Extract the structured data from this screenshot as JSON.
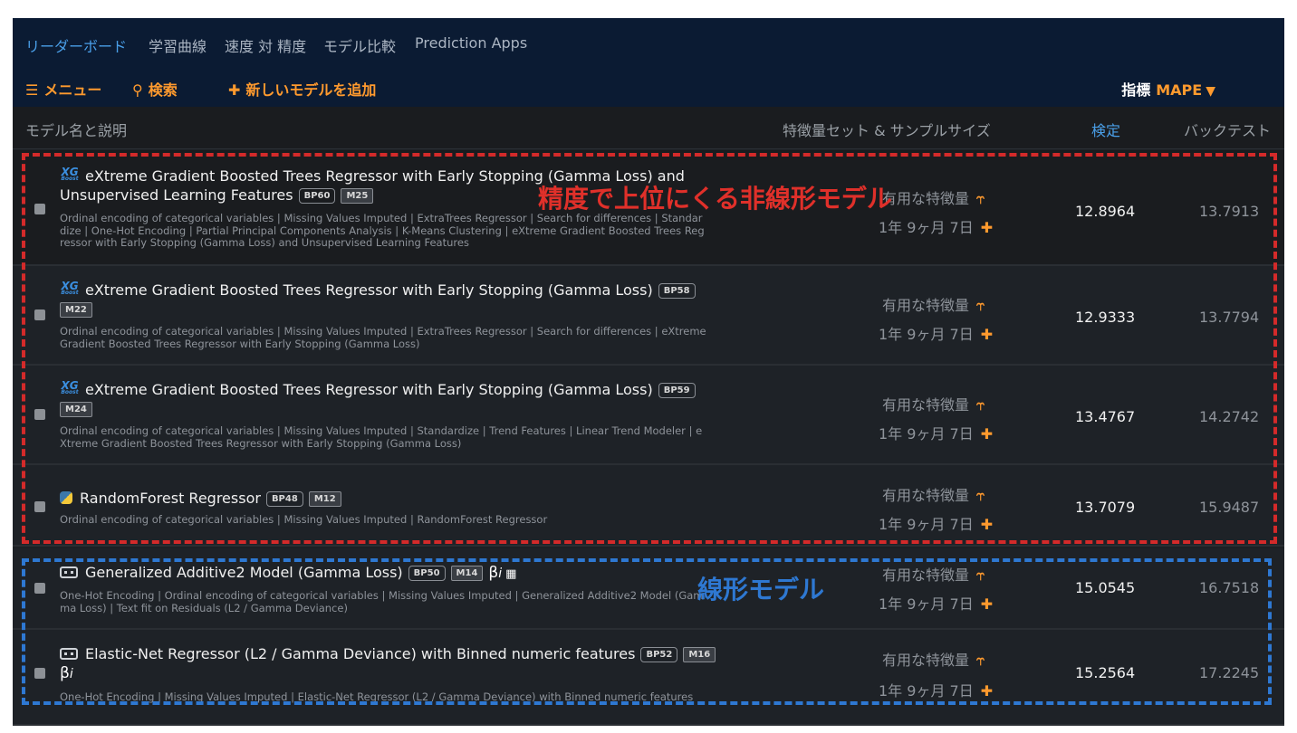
{
  "nav": {
    "tabs": [
      "リーダーボード",
      "学習曲線",
      "速度 対 精度",
      "モデル比較",
      "Prediction Apps"
    ]
  },
  "toolbar": {
    "menu": "メニュー",
    "search": "検索",
    "add_model": "新しいモデルを追加",
    "metric_label": "指標",
    "metric_value": "MAPE"
  },
  "columns": {
    "name": "モデル名と説明",
    "features": "特徴量セット & サンプルサイズ",
    "validation": "検定",
    "backtest": "バックテスト"
  },
  "rows": [
    {
      "title": "eXtreme Gradient Boosted Trees Regressor with Early Stopping (Gamma Loss) and",
      "title2": "Unsupervised Learning Features",
      "bp": "BP60",
      "m": "M25",
      "desc": [
        "Ordinal encoding of categorical variables | Missing Values Imputed | ExtraTrees Regressor | Search for differences | Standar",
        "dize | One-Hot Encoding | Partial Principal Components Analysis | K-Means Clustering | eXtreme Gradient Boosted Trees Reg",
        "ressor with Early Stopping (Gamma Loss) and Unsupervised Learning Features"
      ],
      "features": "有用な特徴量",
      "sample": "1年 9ヶ月 7日",
      "validation": "12.8964",
      "backtest": "13.7913"
    },
    {
      "title": "eXtreme Gradient Boosted Trees Regressor with Early Stopping (Gamma Loss)",
      "bp": "BP58",
      "m": "M22",
      "desc": [
        "Ordinal encoding of categorical variables | Missing Values Imputed | ExtraTrees Regressor | Search for differences | eXtreme",
        "Gradient Boosted Trees Regressor with Early Stopping (Gamma Loss)"
      ],
      "features": "有用な特徴量",
      "sample": "1年 9ヶ月 7日",
      "validation": "12.9333",
      "backtest": "13.7794"
    },
    {
      "title": "eXtreme Gradient Boosted Trees Regressor with Early Stopping (Gamma Loss)",
      "bp": "BP59",
      "m": "M24",
      "desc": [
        "Ordinal encoding of categorical variables | Missing Values Imputed | Standardize | Trend Features | Linear Trend Modeler | e",
        "Xtreme Gradient Boosted Trees Regressor with Early Stopping (Gamma Loss)"
      ],
      "features": "有用な特徴量",
      "sample": "1年 9ヶ月 7日",
      "validation": "13.4767",
      "backtest": "14.2742"
    },
    {
      "title": "RandomForest Regressor",
      "bp": "BP48",
      "m": "M12",
      "desc": [
        "Ordinal encoding of categorical variables | Missing Values Imputed | RandomForest Regressor"
      ],
      "features": "有用な特徴量",
      "sample": "1年 9ヶ月 7日",
      "validation": "13.7079",
      "backtest": "15.9487"
    },
    {
      "title": "Generalized Additive2 Model (Gamma Loss)",
      "bp": "BP50",
      "m": "M14",
      "desc": [
        "One-Hot Encoding | Ordinal encoding of categorical variables | Missing Values Imputed | Generalized Additive2 Model (Gam",
        "ma Loss) | Text fit on Residuals (L2 / Gamma Deviance)"
      ],
      "features": "有用な特徴量",
      "sample": "1年 9ヶ月 7日",
      "validation": "15.0545",
      "backtest": "16.7518"
    },
    {
      "title": "Elastic-Net Regressor (L2 / Gamma Deviance) with Binned numeric features",
      "bp": "BP52",
      "m": "M16",
      "desc": [
        "One-Hot Encoding | Missing Values Imputed | Elastic-Net Regressor (L2 / Gamma Deviance) with Binned numeric features"
      ],
      "features": "有用な特徴量",
      "sample": "1年 9ヶ月 7日",
      "validation": "15.2564",
      "backtest": "17.2245"
    }
  ],
  "icons": {
    "xgboost_line1": "XG",
    "xgboost_line2": "Boost",
    "beta": "β",
    "beta_sub": "i"
  },
  "annotations": {
    "red": "精度で上位にくる非線形モデル",
    "blue": "線形モデル",
    "red_color": "#d42a2a",
    "blue_color": "#2e78d2"
  }
}
